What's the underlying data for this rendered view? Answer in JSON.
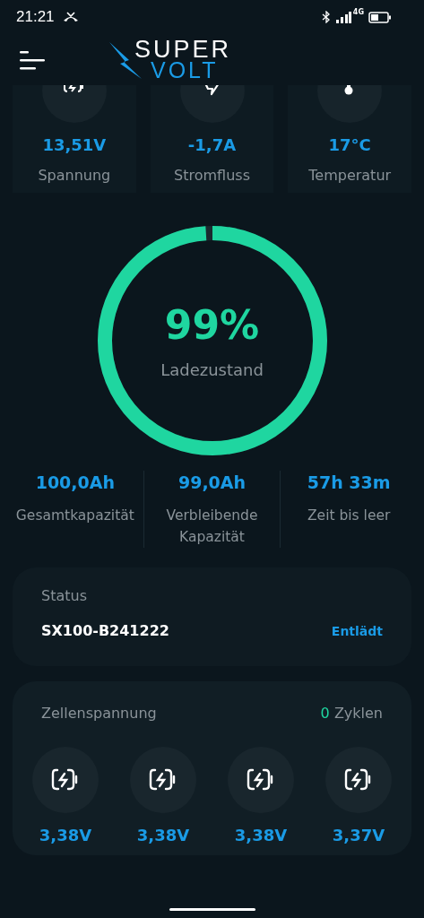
{
  "status_bar": {
    "time": "21:21",
    "network": "4G"
  },
  "header": {
    "logo_top": "SUPER",
    "logo_bottom": "VOLT"
  },
  "metrics": [
    {
      "kind": "voltage",
      "value": "13,51V",
      "label": "Spannung"
    },
    {
      "kind": "current",
      "value": "-1,7A",
      "label": "Stromfluss"
    },
    {
      "kind": "temperature",
      "value": "17°C",
      "label": "Temperatur"
    }
  ],
  "gauge": {
    "value": "99%",
    "label": "Ladezustand",
    "level": 0.99
  },
  "stats": [
    {
      "value": "100,0Ah",
      "label": "Gesamtkapazität"
    },
    {
      "value": "99,0Ah",
      "label": "Verbleibende Kapazität"
    },
    {
      "value": "57h 33m",
      "label": "Zeit bis leer"
    }
  ],
  "status_card": {
    "title": "Status",
    "serial": "SX100-B241222",
    "state": "Entlädt"
  },
  "cells_card": {
    "title": "Zellenspannung",
    "cycles": "0",
    "cycles_label": "Zyklen",
    "cells": [
      {
        "value": "3,38V"
      },
      {
        "value": "3,38V"
      },
      {
        "value": "3,38V"
      },
      {
        "value": "3,37V"
      }
    ]
  }
}
